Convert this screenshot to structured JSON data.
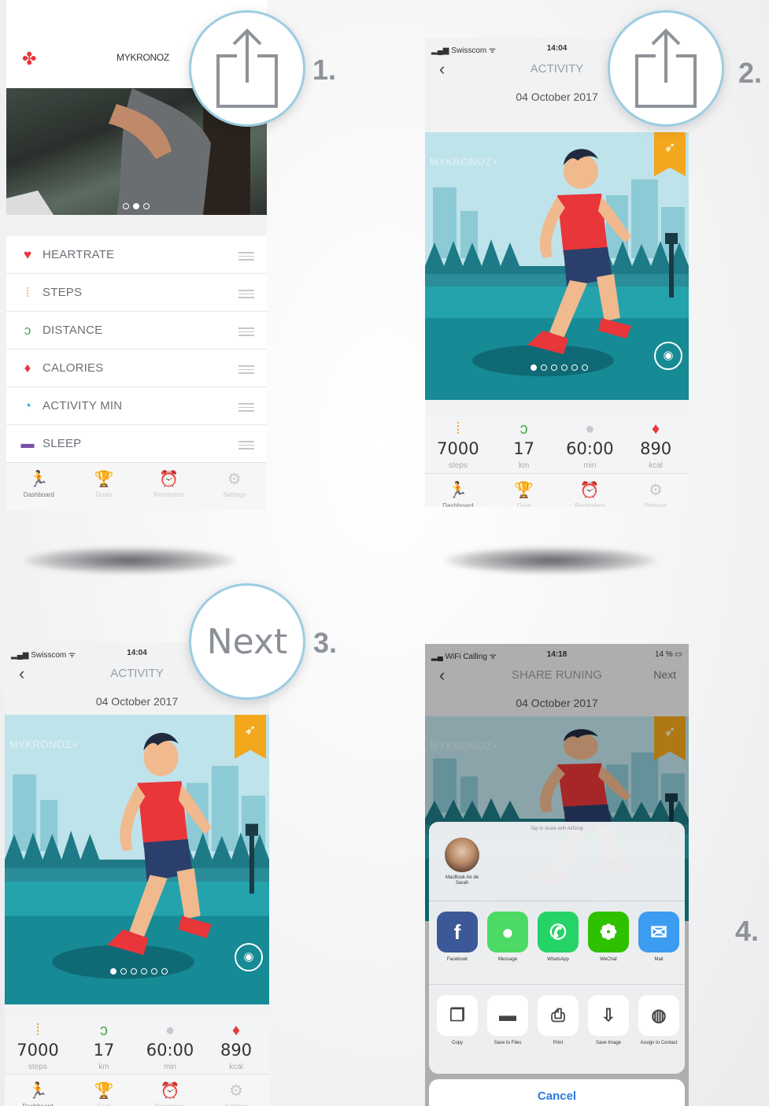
{
  "steps": [
    "1.",
    "2.",
    "3.",
    "4."
  ],
  "callout_next": "Next",
  "screen1": {
    "brand": "MYKRONOZ",
    "metrics": [
      {
        "label": "HEARTRATE",
        "icon": "heart-icon",
        "glyph": "♥",
        "color": "#e53a3c"
      },
      {
        "label": "STEPS",
        "icon": "footprints-icon",
        "glyph": "⁞",
        "color": "#f2a71d"
      },
      {
        "label": "DISTANCE",
        "icon": "distance-icon",
        "glyph": "ↄ",
        "color": "#4aa84a"
      },
      {
        "label": "CALORIES",
        "icon": "flame-icon",
        "glyph": "♦",
        "color": "#e53a3c"
      },
      {
        "label": "ACTIVITY MIN",
        "icon": "timer-icon",
        "glyph": "◔",
        "color": "#3aa0d8"
      },
      {
        "label": "SLEEP",
        "icon": "sleep-icon",
        "glyph": "▬",
        "color": "#7b4fa8"
      }
    ],
    "tabs": [
      "Dashboard",
      "Goals",
      "Reminders",
      "Settings"
    ]
  },
  "activity": {
    "carrier": "Swisscom",
    "time": "14:04",
    "title": "ACTIVITY",
    "date": "04 October 2017",
    "brand": "MYKRONOZ+",
    "stats": [
      {
        "value": "7000",
        "unit": "steps",
        "icon": "footprints-icon",
        "glyph": "⁞",
        "color": "#f2a71d"
      },
      {
        "value": "17",
        "unit": "km",
        "icon": "distance-icon",
        "glyph": "ↄ",
        "color": "#4aa84a"
      },
      {
        "value": "60:00",
        "unit": "min",
        "icon": "clock-icon",
        "glyph": "●",
        "color": "#c8c9cc"
      },
      {
        "value": "890",
        "unit": "kcal",
        "icon": "flame-icon",
        "glyph": "♦",
        "color": "#e53a3c"
      }
    ],
    "tabs": [
      "Dashboard",
      "Goal",
      "Reminders",
      "Settings"
    ]
  },
  "share": {
    "carrier": "WiFi Calling",
    "time": "14:18",
    "battery": "14 %",
    "title": "SHARE RUNING",
    "next": "Next",
    "airdrop_hint": "Tap to share with AirDrop",
    "contact": "MacBook Air de Sarah",
    "apps": [
      {
        "label": "Facebook",
        "icon": "facebook-icon",
        "glyph": "f",
        "color": "#3b5998"
      },
      {
        "label": "Message",
        "icon": "message-icon",
        "glyph": "●",
        "color": "#4cd964"
      },
      {
        "label": "WhatsApp",
        "icon": "whatsapp-icon",
        "glyph": "✆",
        "color": "#25d366"
      },
      {
        "label": "WeChat",
        "icon": "wechat-icon",
        "glyph": "❁",
        "color": "#2dc100"
      },
      {
        "label": "Mail",
        "icon": "mail-icon",
        "glyph": "✉",
        "color": "#3b9cf0"
      }
    ],
    "actions": [
      {
        "label": "Copy",
        "icon": "copy-icon",
        "glyph": "❐"
      },
      {
        "label": "Save to Files",
        "icon": "folder-icon",
        "glyph": "▬"
      },
      {
        "label": "Print",
        "icon": "printer-icon",
        "glyph": "⎙"
      },
      {
        "label": "Save Image",
        "icon": "save-image-icon",
        "glyph": "⇩"
      },
      {
        "label": "Assign to Contact",
        "icon": "contact-icon",
        "glyph": "◍"
      }
    ],
    "cancel": "Cancel"
  }
}
